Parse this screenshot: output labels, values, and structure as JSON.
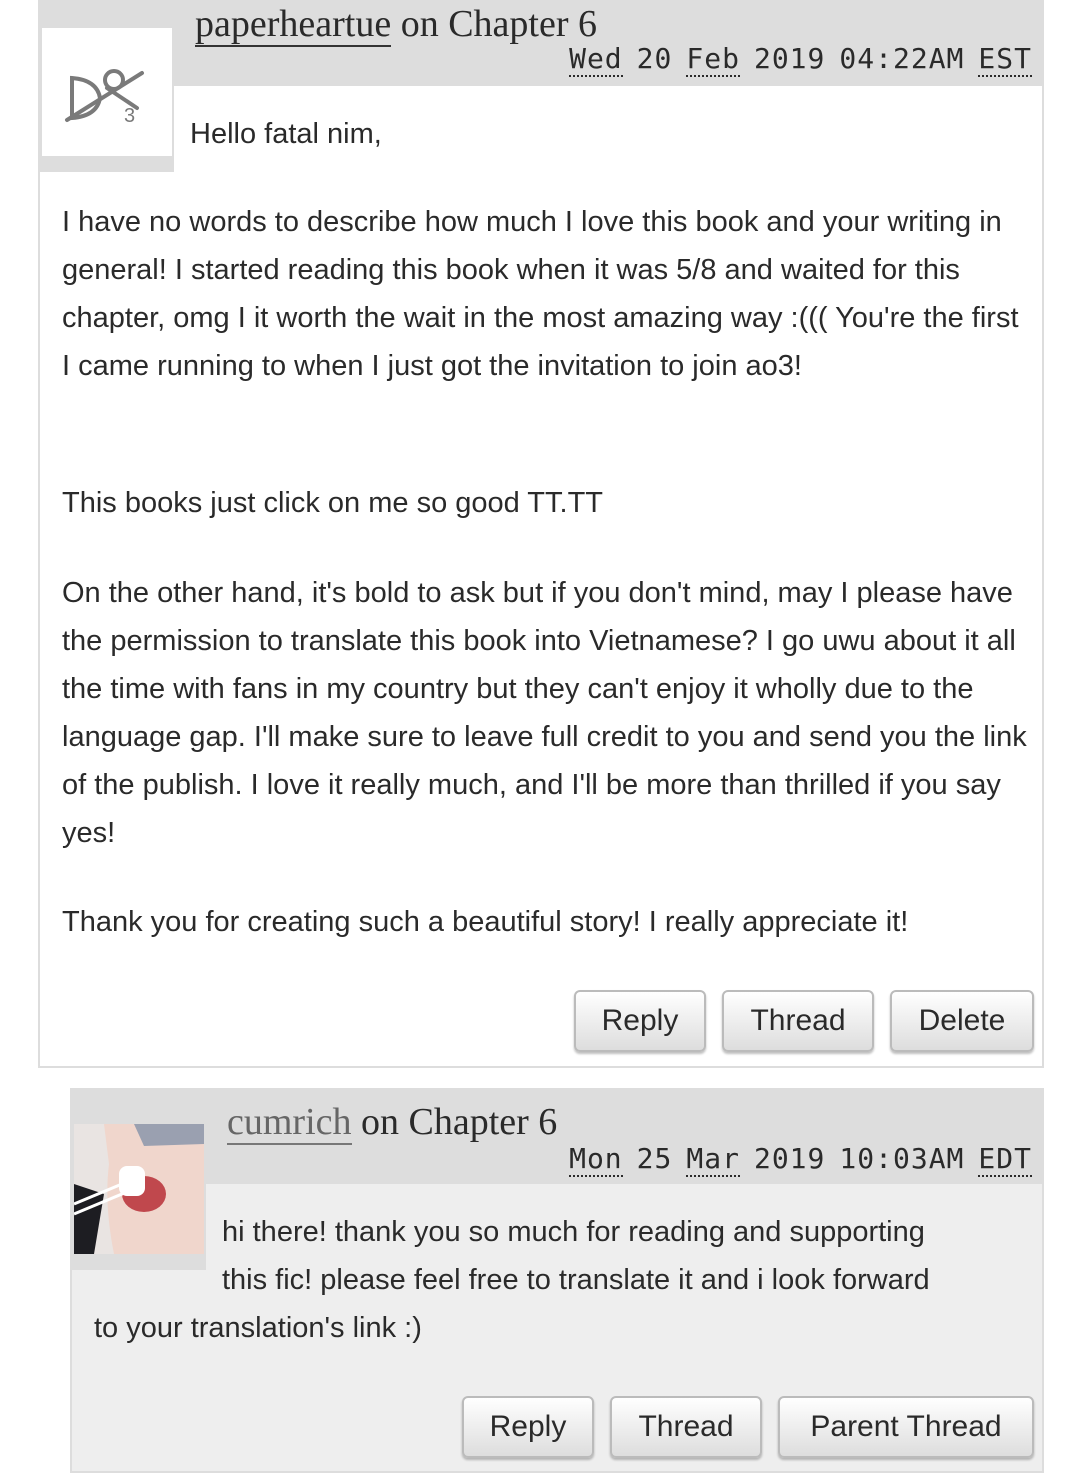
{
  "comments": [
    {
      "author": "paperheartue",
      "on_text": "on Chapter 6",
      "date": {
        "weekday": "Wed",
        "day": "20",
        "month": "Feb",
        "year": "2019",
        "time": "04:22AM",
        "tz": "EST"
      },
      "avatar": "ao3-default-avatar-icon",
      "body": {
        "greeting": "Hello fatal nim,",
        "p1": "I have no words to describe how much I love this book and your writing in general! I started reading this book when it was 5/8 and waited for this chapter, omg I it worth the wait in the most amazing way :((( You're the first I came running to when I just got the invitation to join ao3!",
        "p2": "This books just click on me so good TT.TT",
        "p3": "On the other hand, it's bold to ask but if you don't mind, may I please have the permission to translate this book into Vietnamese? I go uwu about it all the time with fans in my country but they can't enjoy it wholly due to the language gap. I'll make sure to leave full credit to you and send you the link of the publish. I love it really much, and I'll be more than thrilled if you say yes!",
        "p4": "Thank you for creating such a beautiful story! I really appreciate it!"
      },
      "actions": {
        "reply": "Reply",
        "thread": "Thread",
        "delete": "Delete"
      }
    },
    {
      "author": "cumrich",
      "on_text": "on Chapter 6",
      "date": {
        "weekday": "Mon",
        "day": "25",
        "month": "Mar",
        "year": "2019",
        "time": "10:03AM",
        "tz": "EDT"
      },
      "avatar": "user-photo-avatar",
      "body": {
        "line1": "hi there! thank you so much for reading and supporting",
        "line2": "this fic! please feel free to translate it and i look forward",
        "line3": "to your translation's link :)"
      },
      "actions": {
        "reply": "Reply",
        "thread": "Thread",
        "parent_thread": "Parent Thread"
      }
    }
  ]
}
